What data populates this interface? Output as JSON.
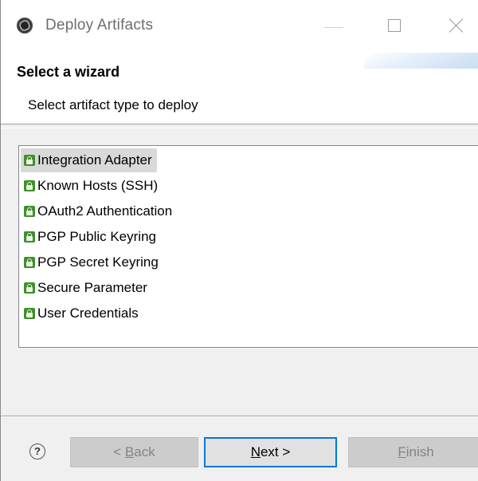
{
  "window": {
    "title": "Deploy Artifacts"
  },
  "header": {
    "wizard_title": "Select a wizard",
    "description": "Select artifact type to deploy"
  },
  "list": {
    "selected_index": 0,
    "items": [
      {
        "label": "Integration Adapter",
        "icon": "lock-icon"
      },
      {
        "label": "Known Hosts (SSH)",
        "icon": "lock-icon"
      },
      {
        "label": "OAuth2 Authentication",
        "icon": "lock-icon"
      },
      {
        "label": "PGP Public Keyring",
        "icon": "lock-icon"
      },
      {
        "label": "PGP Secret Keyring",
        "icon": "lock-icon"
      },
      {
        "label": "Secure Parameter",
        "icon": "lock-icon"
      },
      {
        "label": "User Credentials",
        "icon": "lock-icon"
      }
    ]
  },
  "footer": {
    "help_glyph": "?",
    "back_prefix": "< ",
    "back_mnemonic": "B",
    "back_rest": "ack",
    "next_mnemonic": "N",
    "next_rest": "ext >",
    "finish_mnemonic": "F",
    "finish_rest": "inish"
  },
  "colors": {
    "accent": "#0078d7",
    "icon_green": "#3f8f2a",
    "selection": "#d9d9d9"
  }
}
